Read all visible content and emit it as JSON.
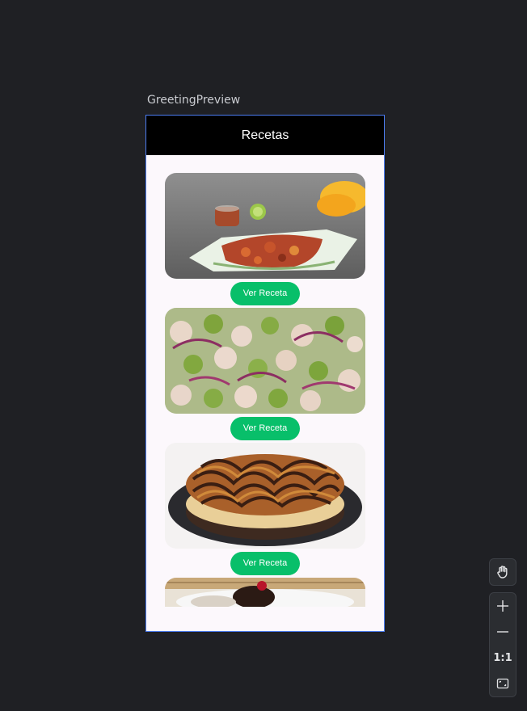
{
  "preview": {
    "label": "GreetingPreview"
  },
  "app": {
    "title": "Recetas",
    "recipes": [
      {
        "button_label": "Ver Receta",
        "image": "fried-snack-basket-photo"
      },
      {
        "button_label": "Ver Receta",
        "image": "ceviche-salad-photo"
      },
      {
        "button_label": "Ver Receta",
        "image": "chocolate-caramel-cheesecake-photo"
      },
      {
        "image": "dessert-with-chocolate-photo"
      }
    ]
  },
  "toolbar": {
    "pan_icon": "hand-icon",
    "zoom_in_icon": "plus-icon",
    "zoom_out_icon": "minus-icon",
    "actual_size_label": "1:1",
    "fit_icon": "fit-screen-icon"
  },
  "colors": {
    "background": "#1f2024",
    "phone_border": "#4c7cf0",
    "topbar": "#000000",
    "screen": "#fcf8fc",
    "button": "#08bf6a"
  }
}
